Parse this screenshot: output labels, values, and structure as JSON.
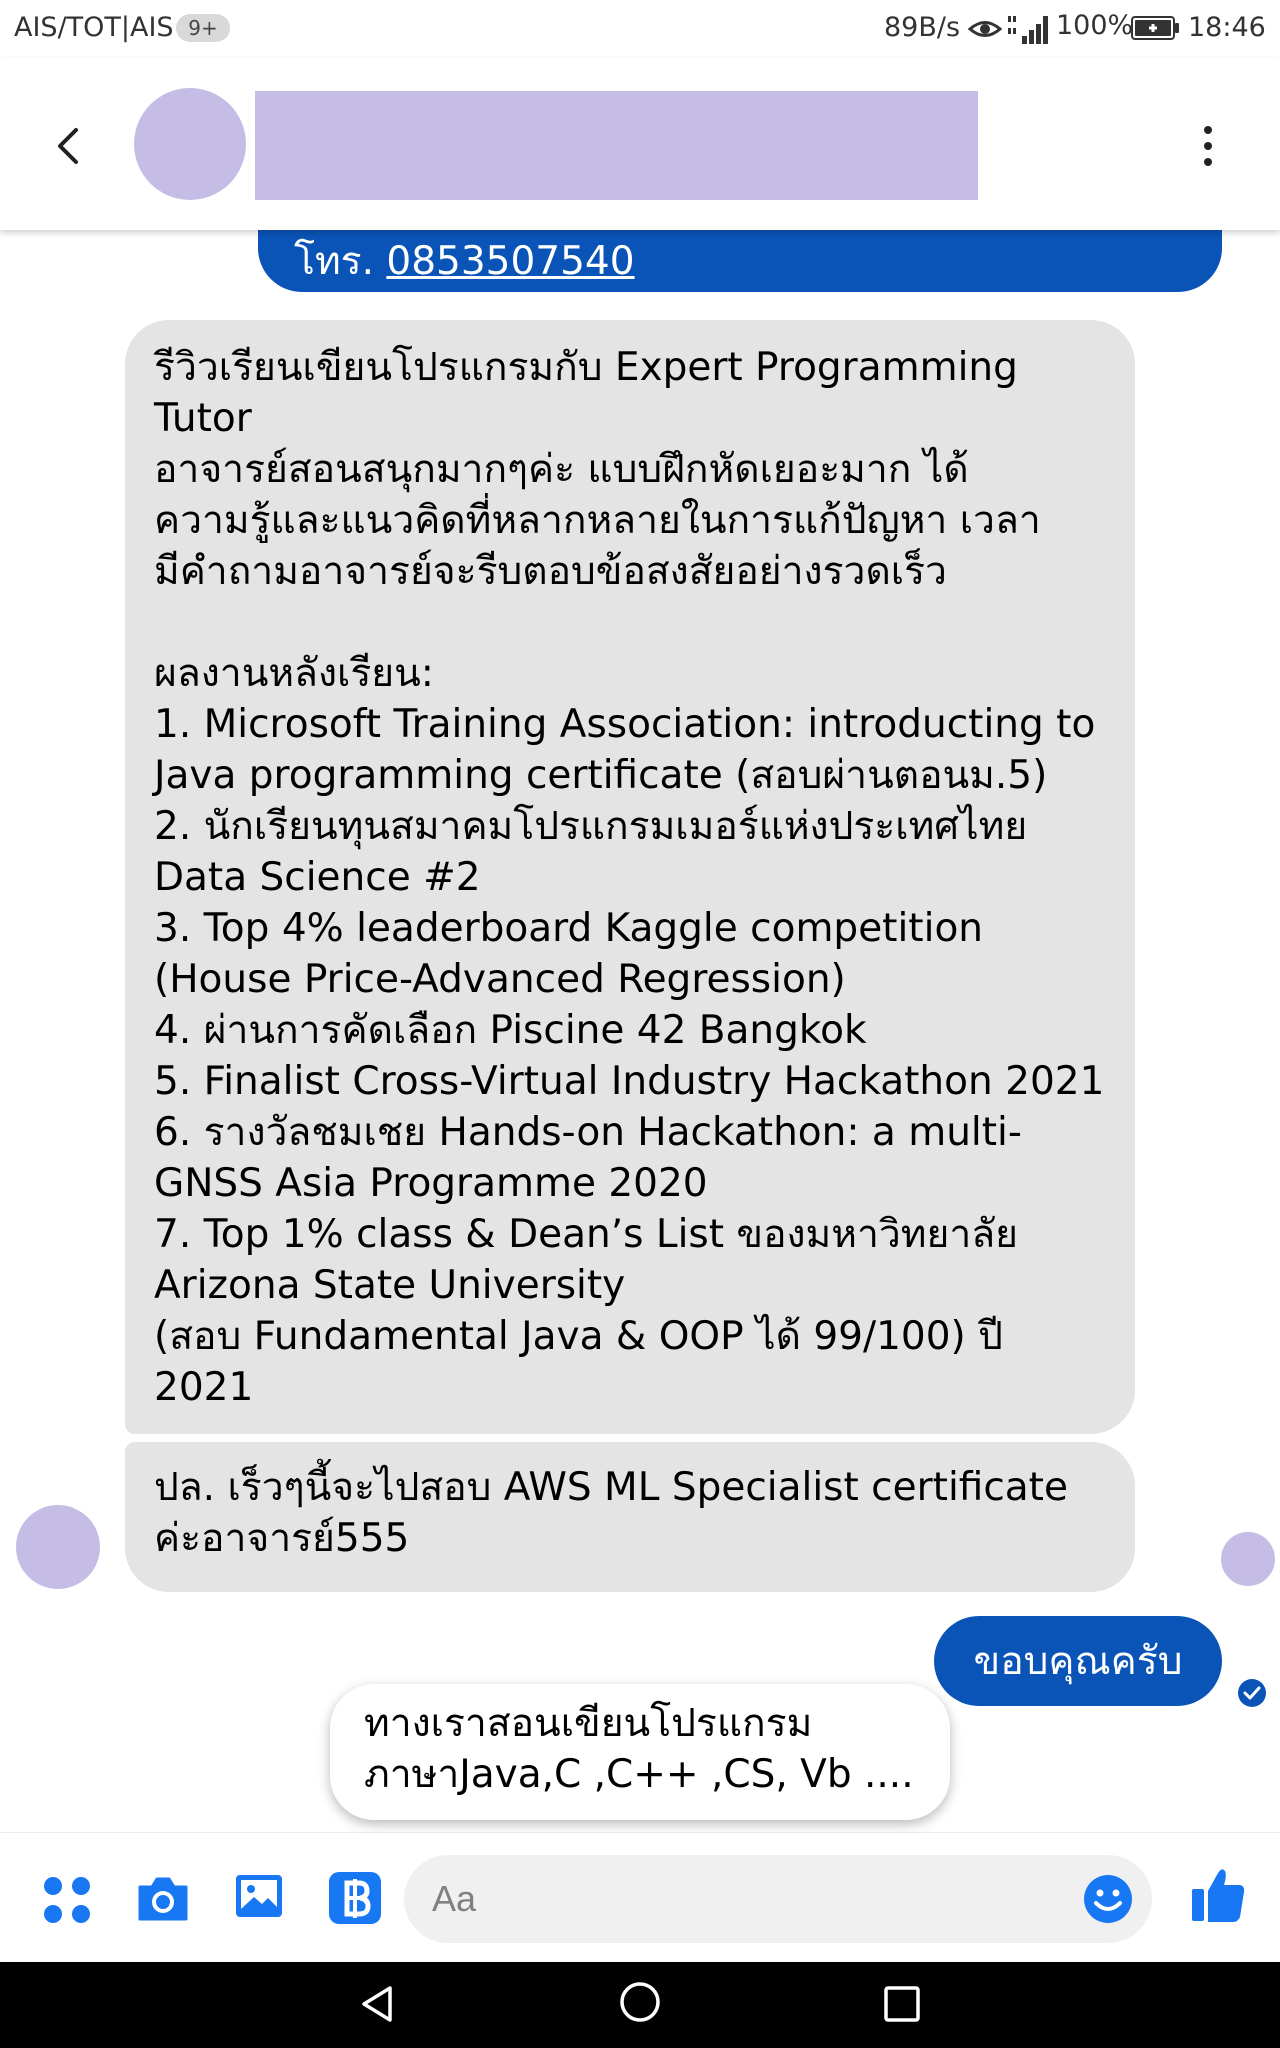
{
  "status_bar": {
    "carrier": "AIS/TOT|AIS",
    "notification_badge": "9+",
    "net_speed": "89B/s",
    "battery": "100%",
    "time": "18:46"
  },
  "header": {
    "back_icon": "chevron-left-icon",
    "more_icon": "vertical-dots-icon"
  },
  "messages": {
    "sent_phone_prefix": "โทร.",
    "sent_phone_number": "0853507540",
    "received_1": "รีวิวเรียนเขียนโปรแกรมกับ Expert Programming\nTutor\nอาจารย์สอนสนุกมากๆค่ะ แบบฝึกหัดเยอะมาก ได้\nความรู้และแนวคิดที่หลากหลายในการแก้ปัญหา เวลา\nมีคำถามอาจารย์จะรีบตอบข้อสงสัยอย่างรวดเร็ว\n\nผลงานหลังเรียน:\n1. Microsoft Training Association: introducting to\nJava programming certificate (สอบผ่านตอนม.5)\n2. นักเรียนทุนสมาคมโปรแกรมเมอร์แห่งประเทศไทย\nData Science #2\n3. Top 4% leaderboard Kaggle competition\n(House Price-Advanced Regression)\n4. ผ่านการคัดเลือก Piscine 42 Bangkok\n5. Finalist Cross-Virtual Industry Hackathon 2021\n6. รางวัลชมเชย Hands-on Hackathon: a multi-\nGNSS Asia Programme 2020\n7. Top 1% class & Dean’s List ของมหาวิทยาลัย\nArizona State University\n(สอบ Fundamental Java & OOP ได้ 99/100) ปี\n2021",
    "received_2": "ปล. เร็วๆนี้จะไปสอบ AWS ML Specialist certificate\nค่ะอาจารย์555",
    "sent_2": "ขอบคุณครับ"
  },
  "quick_reply": {
    "line1": "ทางเราสอนเขียนโปรแกรม",
    "line2": "ภาษาJava,C ,C++ ,CS, Vb ...."
  },
  "composer": {
    "placeholder": "Aa",
    "icons": [
      "apps-icon",
      "camera-icon",
      "gallery-icon",
      "baht-payment-icon",
      "emoji-icon",
      "thumbs-up-icon"
    ]
  },
  "colors": {
    "accent_blue": "#0b54b7",
    "icon_blue": "#1877f2",
    "received_bubble": "#e4e4e4",
    "avatar_placeholder": "#c5bde6"
  }
}
